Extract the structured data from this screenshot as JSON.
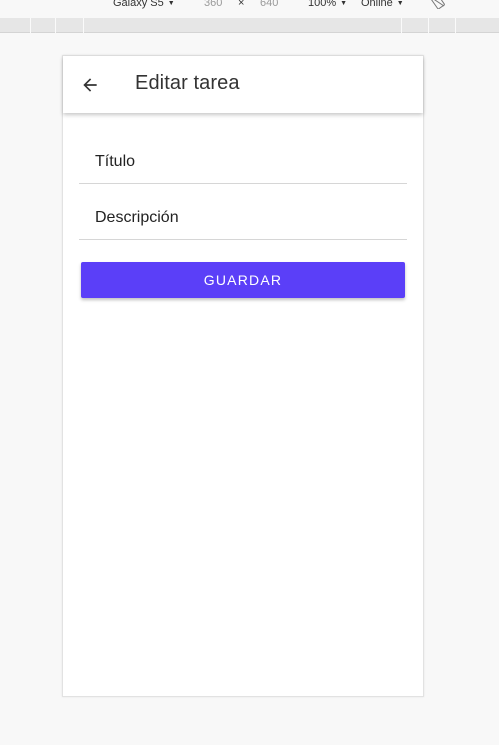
{
  "devtools": {
    "device_name": "Galaxy S5",
    "width": "360",
    "times": "×",
    "height": "640",
    "zoom": "100%",
    "network": "Online",
    "caret": "▼"
  },
  "app_bar": {
    "title": "Editar tarea",
    "back_icon": "arrow-left-icon"
  },
  "form": {
    "title_placeholder": "Título",
    "description_placeholder": "Descripción",
    "save_label": "GUARDAR"
  },
  "colors": {
    "accent": "#5b3ff8",
    "background": "#f8f8f8",
    "surface": "#ffffff"
  }
}
